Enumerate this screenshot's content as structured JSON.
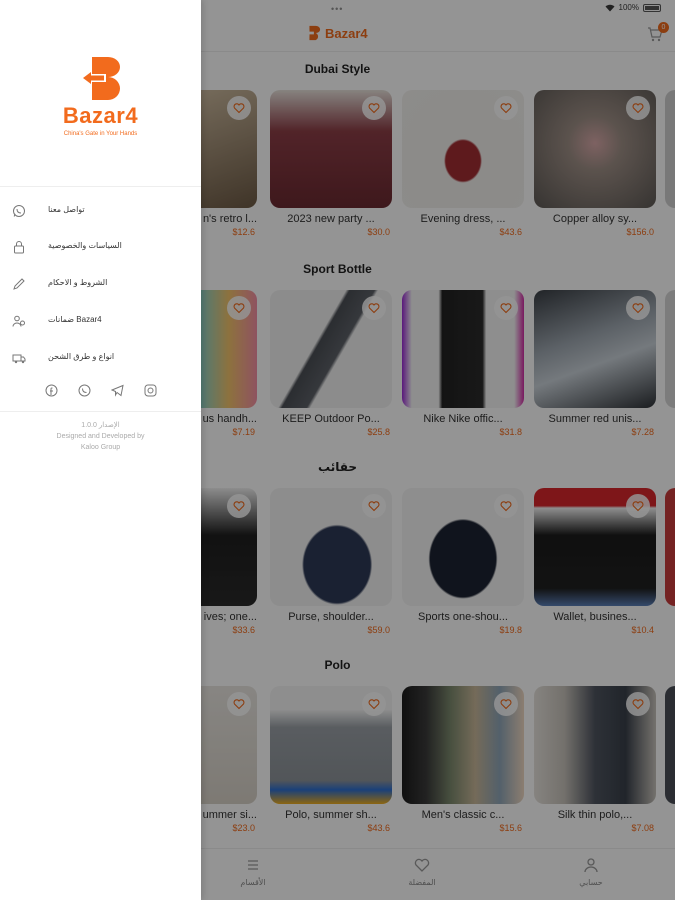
{
  "status_bar": {
    "dots": "•••",
    "battery": "100%"
  },
  "header": {
    "brand": "Bazar4",
    "cart_count": "0"
  },
  "sections": [
    {
      "title": "Dubai Style",
      "items": [
        {
          "name": "n's retro l...",
          "price": "$12.6"
        },
        {
          "name": "2023 new party ...",
          "price": "$30.0"
        },
        {
          "name": "Evening dress, ...",
          "price": "$43.6"
        },
        {
          "name": "Copper alloy sy...",
          "price": "$156.0"
        }
      ]
    },
    {
      "title": "Sport Bottle",
      "items": [
        {
          "name": "us handh...",
          "price": "$7.19"
        },
        {
          "name": "KEEP Outdoor Po...",
          "price": "$25.8"
        },
        {
          "name": "Nike Nike offic...",
          "price": "$31.8"
        },
        {
          "name": "Summer red unis...",
          "price": "$7.28"
        }
      ]
    },
    {
      "title": "حقائب",
      "items": [
        {
          "name": "ives; one...",
          "price": "$33.6"
        },
        {
          "name": "Purse, shoulder...",
          "price": "$59.0"
        },
        {
          "name": "Sports one-shou...",
          "price": "$19.8"
        },
        {
          "name": "Wallet, busines...",
          "price": "$10.4"
        }
      ]
    },
    {
      "title": "Polo",
      "items": [
        {
          "name": "ummer si...",
          "price": "$23.0"
        },
        {
          "name": "Polo, summer sh...",
          "price": "$43.6"
        },
        {
          "name": "Men's classic c...",
          "price": "$15.6"
        },
        {
          "name": "Silk thin polo,...",
          "price": "$7.08"
        }
      ]
    }
  ],
  "bottom_nav": [
    {
      "label": "الأقسام",
      "icon": "list-icon"
    },
    {
      "label": "المفضلة",
      "icon": "heart-icon"
    },
    {
      "label": "حسابي",
      "icon": "user-icon"
    }
  ],
  "drawer": {
    "brand": "Bazar4",
    "tagline": "China's Gate in Your Hands",
    "menu": [
      {
        "label": "تواصل معنا",
        "icon": "whatsapp-icon"
      },
      {
        "label": "السياسات والخصوصية",
        "icon": "lock-icon"
      },
      {
        "label": "الشروط و الاحكام",
        "icon": "pencil-icon"
      },
      {
        "label": "ضمانات Bazar4",
        "icon": "users-icon"
      },
      {
        "label": "انواع و طرق الشحن",
        "icon": "truck-icon"
      }
    ],
    "social": [
      "facebook-icon",
      "whatsapp-icon",
      "telegram-icon",
      "instagram-icon"
    ],
    "version_line": "الإصدار 1.0.0",
    "credit_line1": "Designed and Developed by",
    "credit_line2": "Kaloo Group"
  },
  "colors": {
    "accent": "#f26b1d",
    "overlay": "rgba(0,0,0,0.42)"
  }
}
